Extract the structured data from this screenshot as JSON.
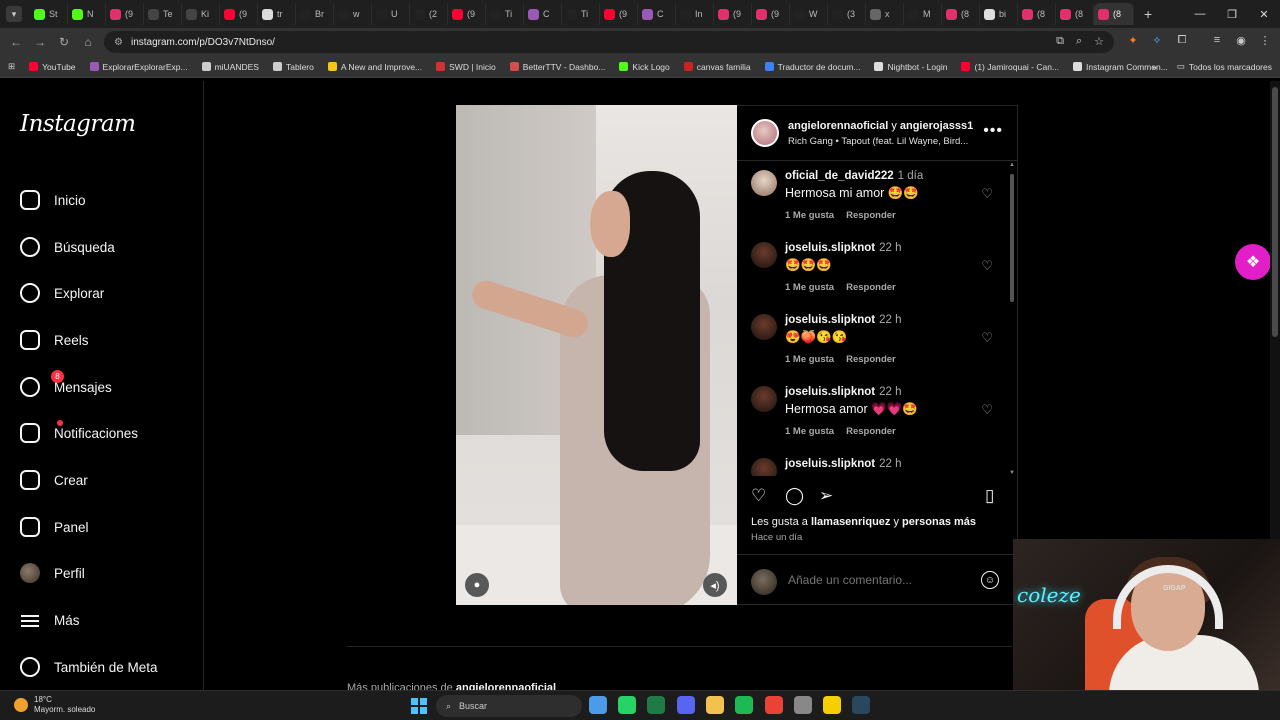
{
  "browser": {
    "url": "instagram.com/p/DO3v7NtDnso/",
    "tabs": [
      {
        "label": "St",
        "color": "#53fc18"
      },
      {
        "label": "N",
        "color": "#53fc18"
      },
      {
        "label": "(9",
        "color": "#e1306c"
      },
      {
        "label": "Te",
        "color": "#444444"
      },
      {
        "label": "Ki",
        "color": "#444444"
      },
      {
        "label": "(9",
        "color": "#ff0033"
      },
      {
        "label": "tr",
        "color": "#dddddd"
      },
      {
        "label": "Br",
        "color": "#222222"
      },
      {
        "label": "w",
        "color": "#222222"
      },
      {
        "label": "U",
        "color": "#222222"
      },
      {
        "label": "(2",
        "color": "#222222"
      },
      {
        "label": "(9",
        "color": "#ff0033"
      },
      {
        "label": "Ti",
        "color": "#222222"
      },
      {
        "label": "C",
        "color": "#9b59b6"
      },
      {
        "label": "Ti",
        "color": "#222222"
      },
      {
        "label": "(9",
        "color": "#ff0033"
      },
      {
        "label": "C",
        "color": "#9b59b6"
      },
      {
        "label": "In",
        "color": "#222222"
      },
      {
        "label": "(9",
        "color": "#e1306c"
      },
      {
        "label": "(9",
        "color": "#e1306c"
      },
      {
        "label": "W",
        "color": "#222222"
      },
      {
        "label": "(3",
        "color": "#222222"
      },
      {
        "label": "x",
        "color": "#666666"
      },
      {
        "label": "M",
        "color": "#222222"
      },
      {
        "label": "(8",
        "color": "#e1306c"
      },
      {
        "label": "bi",
        "color": "#dddddd"
      },
      {
        "label": "(8",
        "color": "#e1306c"
      },
      {
        "label": "(8",
        "color": "#e1306c"
      },
      {
        "label": "(8",
        "color": "#e1306c"
      }
    ],
    "bookmarks": [
      {
        "label": "YouTube",
        "color": "#ff0033"
      },
      {
        "label": "ExplorarExplorarExp...",
        "color": "#9b59b6"
      },
      {
        "label": "miUANDES",
        "color": "#cccccc"
      },
      {
        "label": "Tablero",
        "color": "#cccccc"
      },
      {
        "label": "A New and Improve...",
        "color": "#f5c518"
      },
      {
        "label": "SWD | Inicio",
        "color": "#cc3333"
      },
      {
        "label": "BetterTTV - Dashbo...",
        "color": "#d44c4c"
      },
      {
        "label": "Kick Logo",
        "color": "#53fc18"
      },
      {
        "label": "canvas familia",
        "color": "#cc2222"
      },
      {
        "label": "Traductor de docum...",
        "color": "#3b82f6"
      },
      {
        "label": "Nightbot - Login",
        "color": "#dddddd"
      },
      {
        "label": "(1) Jamiroquai - Can...",
        "color": "#ff0033"
      },
      {
        "label": "Instagram Commen...",
        "color": "#dddddd"
      }
    ],
    "all_bookmarks": "Todos los marcadores"
  },
  "sidebar": {
    "logo": "Instagram",
    "items": [
      {
        "label": "Inicio",
        "icon": "home-icon"
      },
      {
        "label": "Búsqueda",
        "icon": "search-icon"
      },
      {
        "label": "Explorar",
        "icon": "compass-icon"
      },
      {
        "label": "Reels",
        "icon": "reels-icon"
      },
      {
        "label": "Mensajes",
        "icon": "messenger-icon",
        "badge": "8"
      },
      {
        "label": "Notificaciones",
        "icon": "heart-icon"
      },
      {
        "label": "Crear",
        "icon": "plus-icon"
      },
      {
        "label": "Panel",
        "icon": "chart-icon"
      },
      {
        "label": "Perfil",
        "icon": "avatar"
      },
      {
        "label": "Más",
        "icon": "menu-icon"
      },
      {
        "label": "También de Meta",
        "icon": "meta-icon"
      }
    ]
  },
  "post": {
    "author": "angielorennaoficial",
    "connector": "y",
    "coauthor": "angierojasss1",
    "audio": "Rich Gang • Tapout (feat. Lil Wayne, Bird...",
    "comments": [
      {
        "user": "oficial_de_david222",
        "time": "1 día",
        "text": "Hermosa mi amor 🤩🤩",
        "likes": "1 Me gusta",
        "reply": "Responder"
      },
      {
        "user": "joseluis.slipknot",
        "time": "22 h",
        "text": "🤩🤩🤩",
        "likes": "1 Me gusta",
        "reply": "Responder"
      },
      {
        "user": "joseluis.slipknot",
        "time": "22 h",
        "text": "😍🍑😘😘",
        "likes": "1 Me gusta",
        "reply": "Responder"
      },
      {
        "user": "joseluis.slipknot",
        "time": "22 h",
        "text": "Hermosa amor 💗💗🤩",
        "likes": "1 Me gusta",
        "reply": "Responder"
      },
      {
        "user": "joseluis.slipknot",
        "time": "22 h",
        "text": "",
        "likes": "",
        "reply": ""
      }
    ],
    "likes_prefix": "Les gusta a",
    "likes_user": "llamasenriquez",
    "likes_connector": "y",
    "likes_others": "personas más",
    "date": "Hace un día",
    "comment_placeholder": "Añade un comentario..."
  },
  "more_posts": {
    "prefix": "Más publicaciones de",
    "user": "angielorennaoficial"
  },
  "webcam": {
    "neon": "coleze",
    "headset_brand": "GIGAP"
  },
  "taskbar": {
    "temperature": "18°C",
    "weather": "Mayorm. soleado",
    "search_label": "Buscar",
    "apps": [
      {
        "name": "files-app",
        "color": "#4c9be8"
      },
      {
        "name": "whatsapp-app",
        "color": "#25d366"
      },
      {
        "name": "excel-app",
        "color": "#1f7a45"
      },
      {
        "name": "discord-app",
        "color": "#5865f2"
      },
      {
        "name": "explorer-app",
        "color": "#f2c14e"
      },
      {
        "name": "spotify-app",
        "color": "#1db954"
      },
      {
        "name": "chrome-app",
        "color": "#ea4335"
      },
      {
        "name": "settings-app",
        "color": "#888888"
      },
      {
        "name": "notes-app",
        "color": "#f5d000"
      },
      {
        "name": "steam-app",
        "color": "#2a475e"
      }
    ]
  }
}
